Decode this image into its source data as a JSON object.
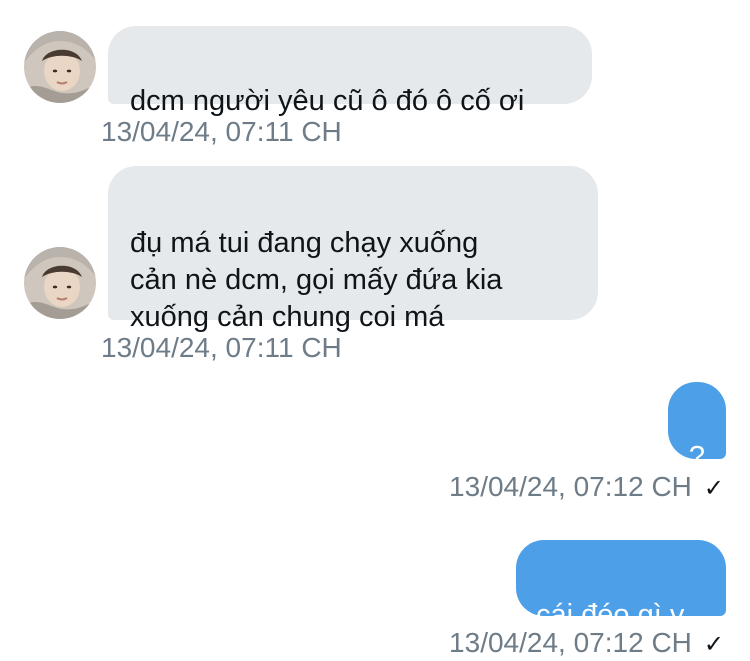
{
  "messages": [
    {
      "direction": "received",
      "text": "dcm người yêu cũ ô đó ô cố ơi",
      "timestamp": "13/04/24, 07:11 CH"
    },
    {
      "direction": "received",
      "text": "đụ má tui đang chạy xuống\ncản nè dcm, gọi mấy đứa kia\nxuống cản chung coi má",
      "timestamp": "13/04/24, 07:11 CH"
    },
    {
      "direction": "sent",
      "text": "?",
      "timestamp": "13/04/24, 07:12 CH",
      "status_icon": "checkmark-icon",
      "status_glyph": "✓"
    },
    {
      "direction": "sent",
      "text": "cái đéo gì v",
      "timestamp": "13/04/24, 07:12 CH",
      "status_icon": "checkmark-icon",
      "status_glyph": "✓"
    }
  ],
  "colors": {
    "received_bubble": "#e6e9ec",
    "sent_bubble": "#4d9fe8",
    "timestamp": "#6e7c88"
  }
}
